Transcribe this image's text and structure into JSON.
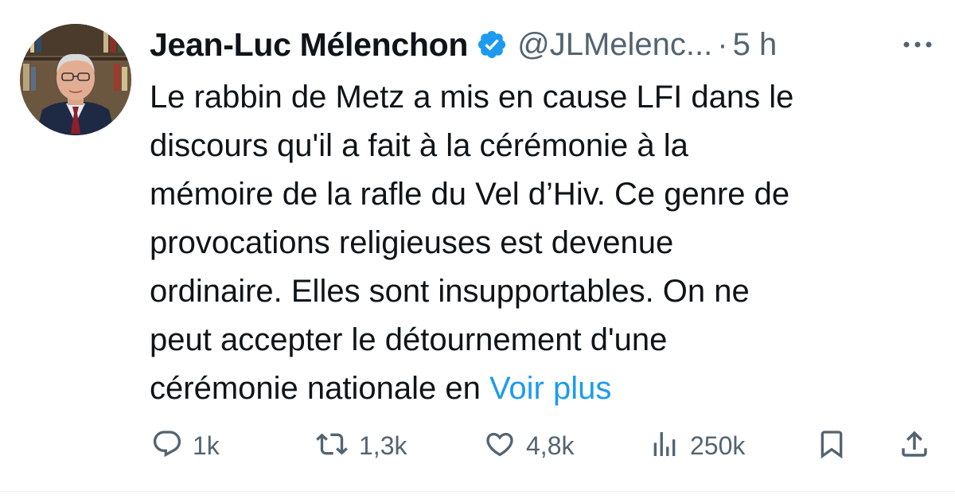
{
  "author": {
    "display_name": "Jean-Luc Mélenchon",
    "handle": "@JLMelenc...",
    "separator": "·",
    "time": "5 h",
    "verified": true
  },
  "icons": {
    "verified": "verified-badge-icon",
    "more": "more-options-icon",
    "reply": "reply-icon",
    "retweet": "retweet-icon",
    "like": "heart-icon",
    "views": "views-icon",
    "bookmark": "bookmark-icon",
    "share": "share-icon"
  },
  "tweet": {
    "lines": [
      "Le rabbin de Metz a mis en cause LFI dans le",
      "discours qu'il a fait à la cérémonie à la",
      "mémoire de la rafle du Vel d’Hiv. Ce genre de",
      "provocations religieuses est devenue",
      "ordinaire. Elles sont insupportables. On ne",
      "peut accepter le détournement d'une",
      "cérémonie nationale en "
    ],
    "see_more": "Voir plus"
  },
  "actions": {
    "replies": "1k",
    "retweets": "1,3k",
    "likes": "4,8k",
    "views": "250k"
  },
  "colors": {
    "text": "#0f1419",
    "secondary": "#536471",
    "accent": "#1d9bf0"
  }
}
